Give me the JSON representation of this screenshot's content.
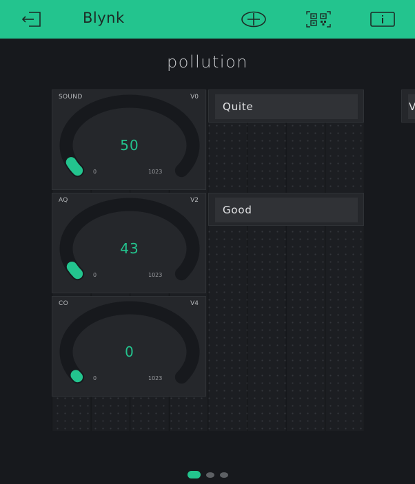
{
  "header": {
    "title": "Blynk",
    "icons": [
      "exit-icon",
      "add-icon",
      "qr-code-icon",
      "info-icon"
    ]
  },
  "project": {
    "name": "pollution"
  },
  "gauges": [
    {
      "label": "SOUND",
      "pin": "V0",
      "value": "50",
      "min": "0",
      "max": "1023",
      "fraction": 0.049
    },
    {
      "label": "AQ",
      "pin": "V2",
      "value": "43",
      "min": "0",
      "max": "1023",
      "fraction": 0.042
    },
    {
      "label": "CO",
      "pin": "V4",
      "value": "0",
      "min": "0",
      "max": "1023",
      "fraction": 0.0
    }
  ],
  "labels": [
    {
      "text": "Quite"
    },
    {
      "text": "Good"
    }
  ],
  "edge_widget": {
    "text": "V"
  },
  "pager": {
    "page_count": 3,
    "active_page": 1
  },
  "colors": {
    "accent": "#23c48e",
    "background": "#17191d",
    "widget": "#25272b"
  }
}
